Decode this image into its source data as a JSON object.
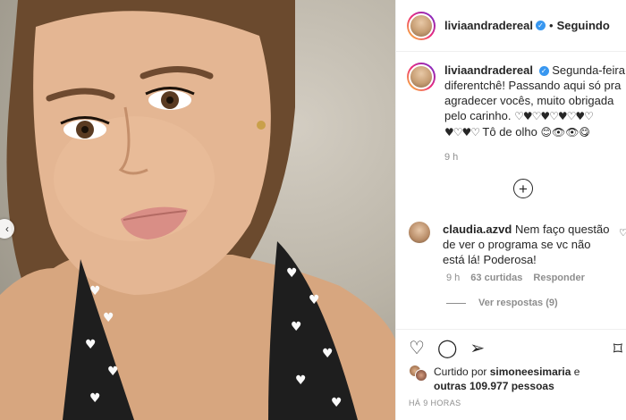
{
  "post": {
    "username": "livia​andradereal",
    "follow_status": "Seguindo",
    "separator": "•"
  },
  "caption": {
    "username": "livia​andradereal",
    "line1": "Segunda-feira diferentchê! Passando aqui só pra agradecer vocês, muito obrigada pelo carinho.",
    "hearts1": "♡♥♡♥♡♥♡♥♡",
    "hearts2": "♥♡♥♡",
    "line2": " Tô de olho ",
    "emoji_tail": "😊👁👁😋",
    "time": "9 h"
  },
  "comment": {
    "username": "claudia.azvd",
    "text": "Nem faço questão de ver o programa se vc não está lá! Poderosa!",
    "time": "9 h",
    "likes": "63 curtidas",
    "reply": "Responder",
    "view_replies": "Ver respostas (9)"
  },
  "actions": {
    "like_icon": "heart-icon",
    "comment_icon": "comment-icon",
    "share_icon": "share-icon",
    "save_icon": "bookmark-icon"
  },
  "likes": {
    "prefix": "Curtido por ",
    "user": "simoneesimaria",
    "middle": " e",
    "others": "outras 109.977 pessoas"
  },
  "timestamp": "HÁ 9 HORAS",
  "colors": {
    "verified": "#3897f0",
    "muted": "#8e8e8e",
    "text": "#262626"
  }
}
